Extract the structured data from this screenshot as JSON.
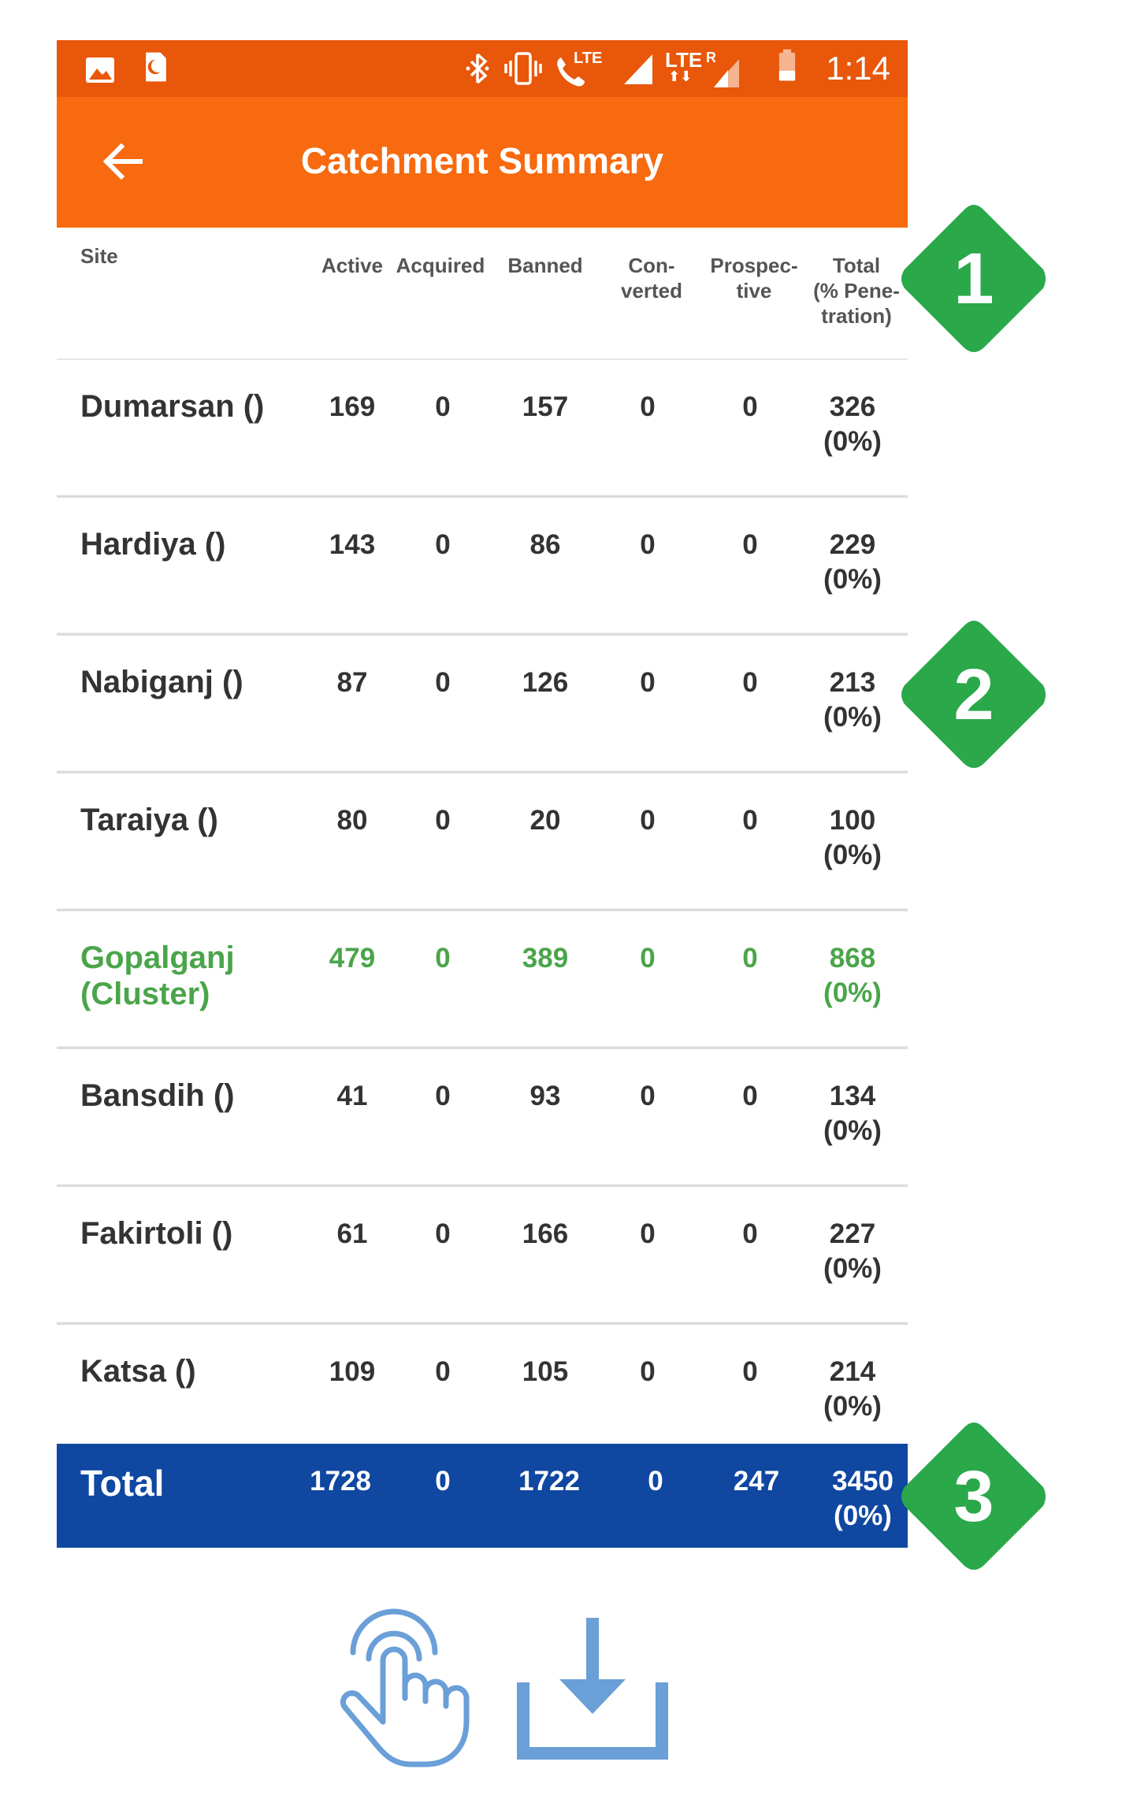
{
  "colors": {
    "status_bar": "#e8570a",
    "app_bar": "#f76a10",
    "total_bar": "#0f47a1",
    "cluster_text": "#4aa54a",
    "badge": "#2aa84a",
    "action_icons": "#6a9fd8"
  },
  "status_bar": {
    "time": "1:14",
    "icons": [
      "image-icon",
      "sim-card-icon",
      "bluetooth-icon",
      "vibrate-icon",
      "volte-call-icon",
      "signal-icon",
      "lte-signal-icon",
      "battery-icon"
    ],
    "volte_label": "LTE",
    "lte_label": "LTE",
    "roaming_label": "R"
  },
  "app_bar": {
    "title": "Catchment Summary",
    "back_icon": "arrow-left-icon"
  },
  "table": {
    "headers": {
      "site": "Site",
      "active": "Active",
      "acquired": "Acquired",
      "banned": "Banned",
      "converted_1": "Con-",
      "converted_2": "verted",
      "prospective_1": "Prospec-",
      "prospective_2": "tive",
      "total_1": "Total",
      "total_2": "(% Pene-",
      "total_3": "tration)"
    },
    "rows": [
      {
        "site": "Dumarsan ()",
        "active": "169",
        "acquired": "0",
        "banned": "157",
        "converted": "0",
        "prospective": "0",
        "total": "326",
        "pct": "(0%)"
      },
      {
        "site": "Hardiya ()",
        "active": "143",
        "acquired": "0",
        "banned": "86",
        "converted": "0",
        "prospective": "0",
        "total": "229",
        "pct": "(0%)"
      },
      {
        "site": "Nabiganj ()",
        "active": "87",
        "acquired": "0",
        "banned": "126",
        "converted": "0",
        "prospective": "0",
        "total": "213",
        "pct": "(0%)"
      },
      {
        "site": "Taraiya ()",
        "active": "80",
        "acquired": "0",
        "banned": "20",
        "converted": "0",
        "prospective": "0",
        "total": "100",
        "pct": "(0%)"
      },
      {
        "site": "Gopalganj",
        "site_2": "(Cluster)",
        "active": "479",
        "acquired": "0",
        "banned": "389",
        "converted": "0",
        "prospective": "0",
        "total": "868",
        "pct": "(0%)"
      },
      {
        "site": "Bansdih ()",
        "active": "41",
        "acquired": "0",
        "banned": "93",
        "converted": "0",
        "prospective": "0",
        "total": "134",
        "pct": "(0%)"
      },
      {
        "site": "Fakirtoli ()",
        "active": "61",
        "acquired": "0",
        "banned": "166",
        "converted": "0",
        "prospective": "0",
        "total": "227",
        "pct": "(0%)"
      },
      {
        "site": "Katsa ()",
        "active": "109",
        "acquired": "0",
        "banned": "105",
        "converted": "0",
        "prospective": "0",
        "total": "214",
        "pct": "(0%)"
      }
    ],
    "total": {
      "label": "Total",
      "active": "1728",
      "acquired": "0",
      "banned": "1722",
      "converted": "0",
      "prospective": "247",
      "total": "3450",
      "pct": "(0%)"
    }
  },
  "badges": [
    "1",
    "2",
    "3"
  ],
  "actions": {
    "tap_icon": "hand-tap-icon",
    "download_icon": "download-icon"
  }
}
